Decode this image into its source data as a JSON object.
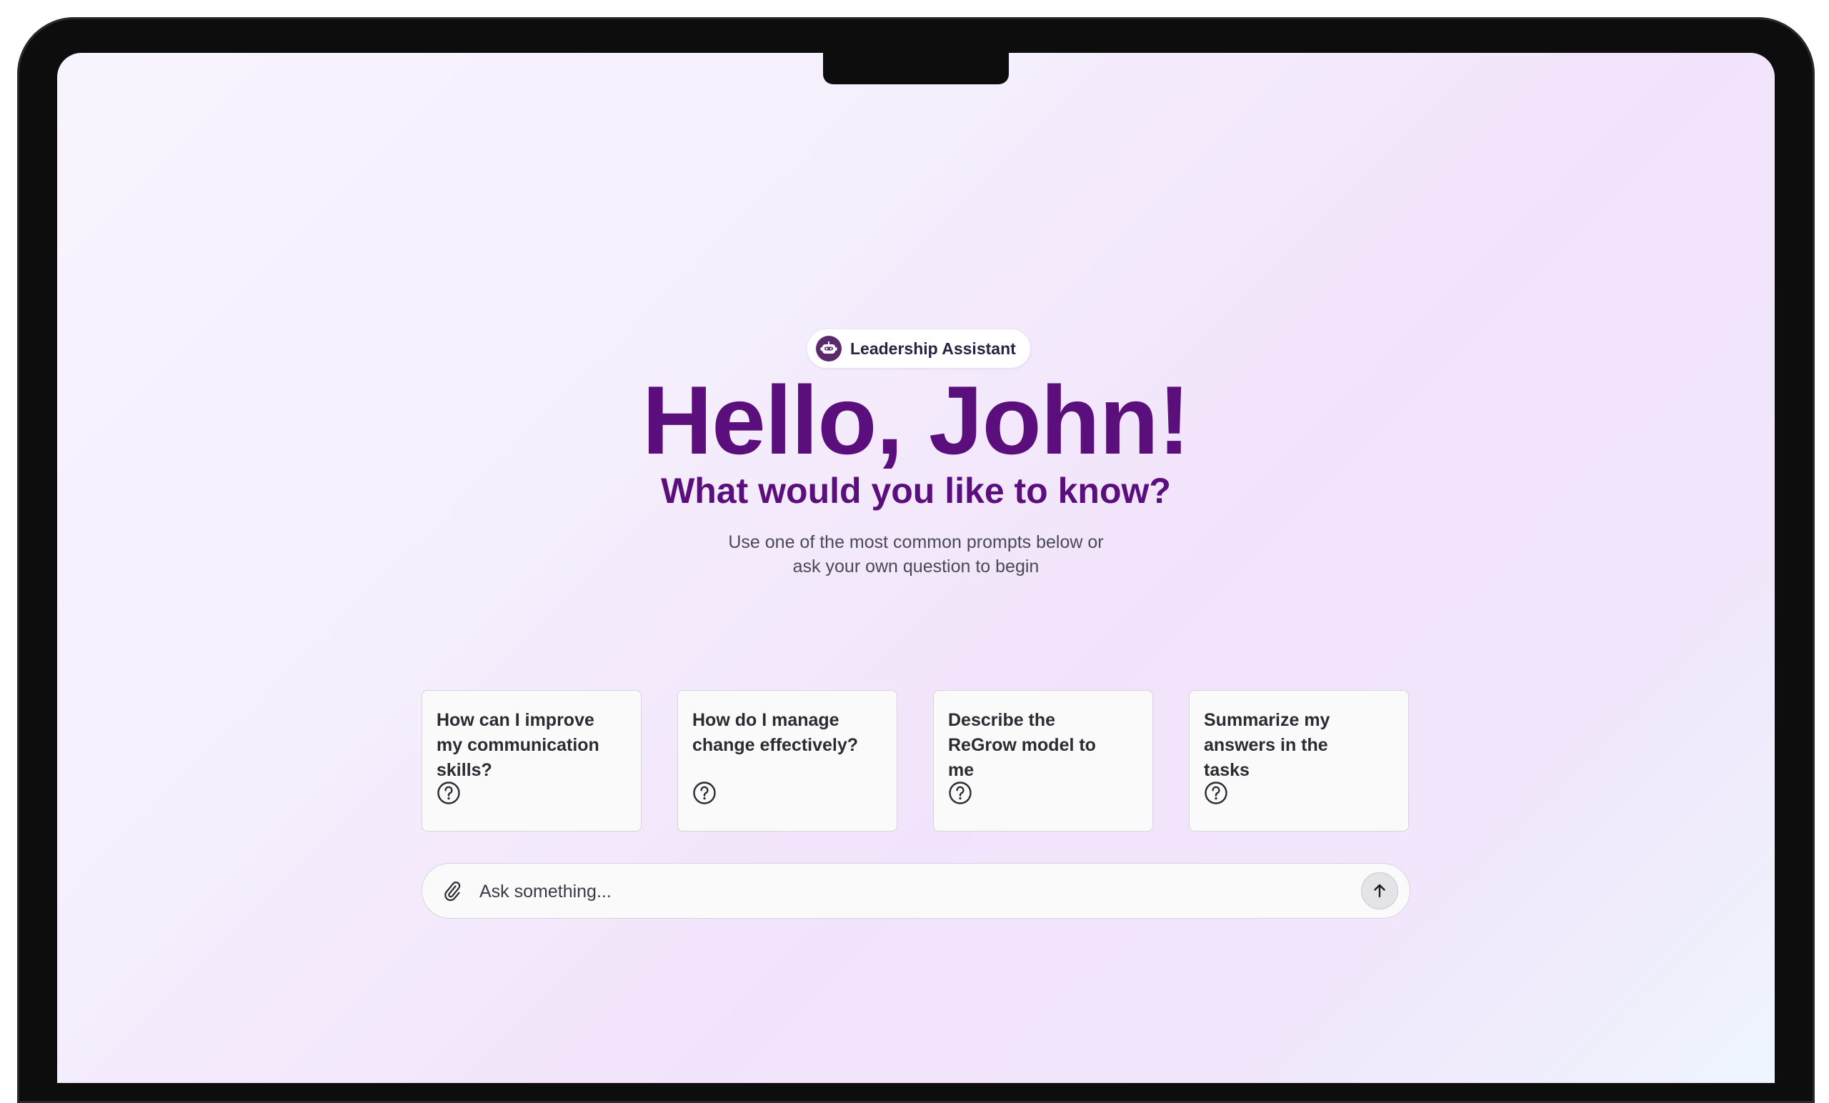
{
  "assistant": {
    "name": "Leadership Assistant",
    "icon": "robot-icon"
  },
  "hero": {
    "greeting": "Hello, John!",
    "subtitle": "What would you like to know?",
    "hint_line1": "Use one of the most common prompts below or",
    "hint_line2": "ask your own question to begin"
  },
  "prompts": [
    {
      "text": "How can I improve my communication skills?",
      "icon": "help-circle-icon"
    },
    {
      "text": "How do I manage change effectively?",
      "icon": "help-circle-icon"
    },
    {
      "text": "Describe the ReGrow model to me",
      "icon": "help-circle-icon"
    },
    {
      "text": "Summarize my answers in the tasks",
      "icon": "help-circle-icon"
    }
  ],
  "input": {
    "placeholder": "Ask something...",
    "value": "",
    "attach_icon": "paperclip-icon",
    "send_icon": "arrow-up-icon"
  },
  "colors": {
    "brand": "#5b0f7d",
    "robot_badge": "#5b2a6e"
  }
}
